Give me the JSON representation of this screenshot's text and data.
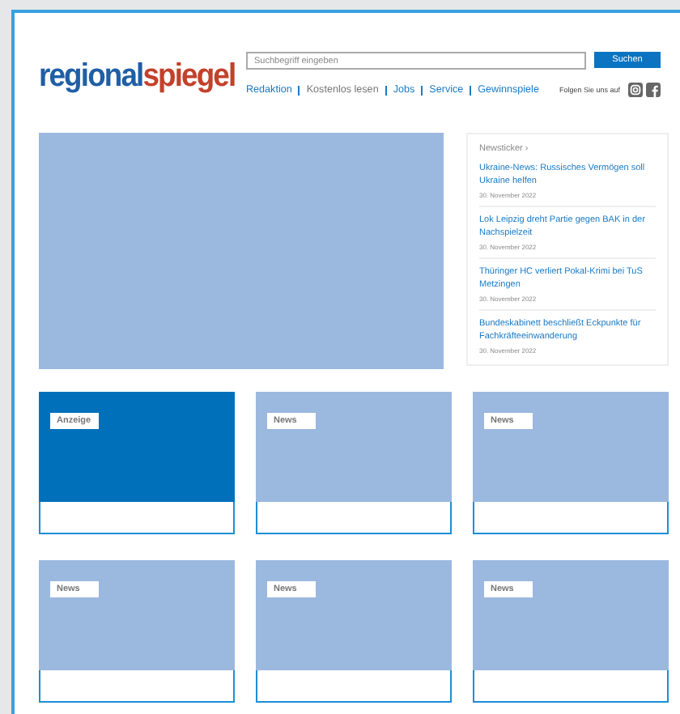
{
  "logo": {
    "first": "regional",
    "second": "spiegel"
  },
  "search": {
    "placeholder": "Suchbegriff eingeben",
    "button": "Suchen"
  },
  "nav": [
    {
      "label": "Redaktion",
      "muted": false
    },
    {
      "label": "Kostenlos lesen",
      "muted": true
    },
    {
      "label": "Jobs",
      "muted": false
    },
    {
      "label": "Service",
      "muted": false
    },
    {
      "label": "Gewinnspiele",
      "muted": false
    }
  ],
  "social": {
    "label": "Folgen Sie uns auf"
  },
  "newsticker": {
    "title": "Newsticker ›",
    "items": [
      {
        "headline": "Ukraine-News: Russisches Vermögen soll Ukraine helfen",
        "date": "30. November 2022"
      },
      {
        "headline": "Lok Leipzig dreht Partie gegen BAK in der Nachspielzeit",
        "date": "30. November 2022"
      },
      {
        "headline": "Thüringer HC verliert Pokal-Krimi bei TuS Metzingen",
        "date": "30. November 2022"
      },
      {
        "headline": "Bundeskabinett beschließt Eckpunkte für Fachkräfteeinwanderung",
        "date": "30. November 2022"
      }
    ]
  },
  "cards": [
    {
      "kind": "ad",
      "tag": "Anzeige"
    },
    {
      "kind": "news",
      "tag": "News"
    },
    {
      "kind": "news",
      "tag": "News"
    },
    {
      "kind": "news",
      "tag": "News"
    },
    {
      "kind": "news",
      "tag": "News"
    },
    {
      "kind": "news",
      "tag": "News"
    }
  ]
}
